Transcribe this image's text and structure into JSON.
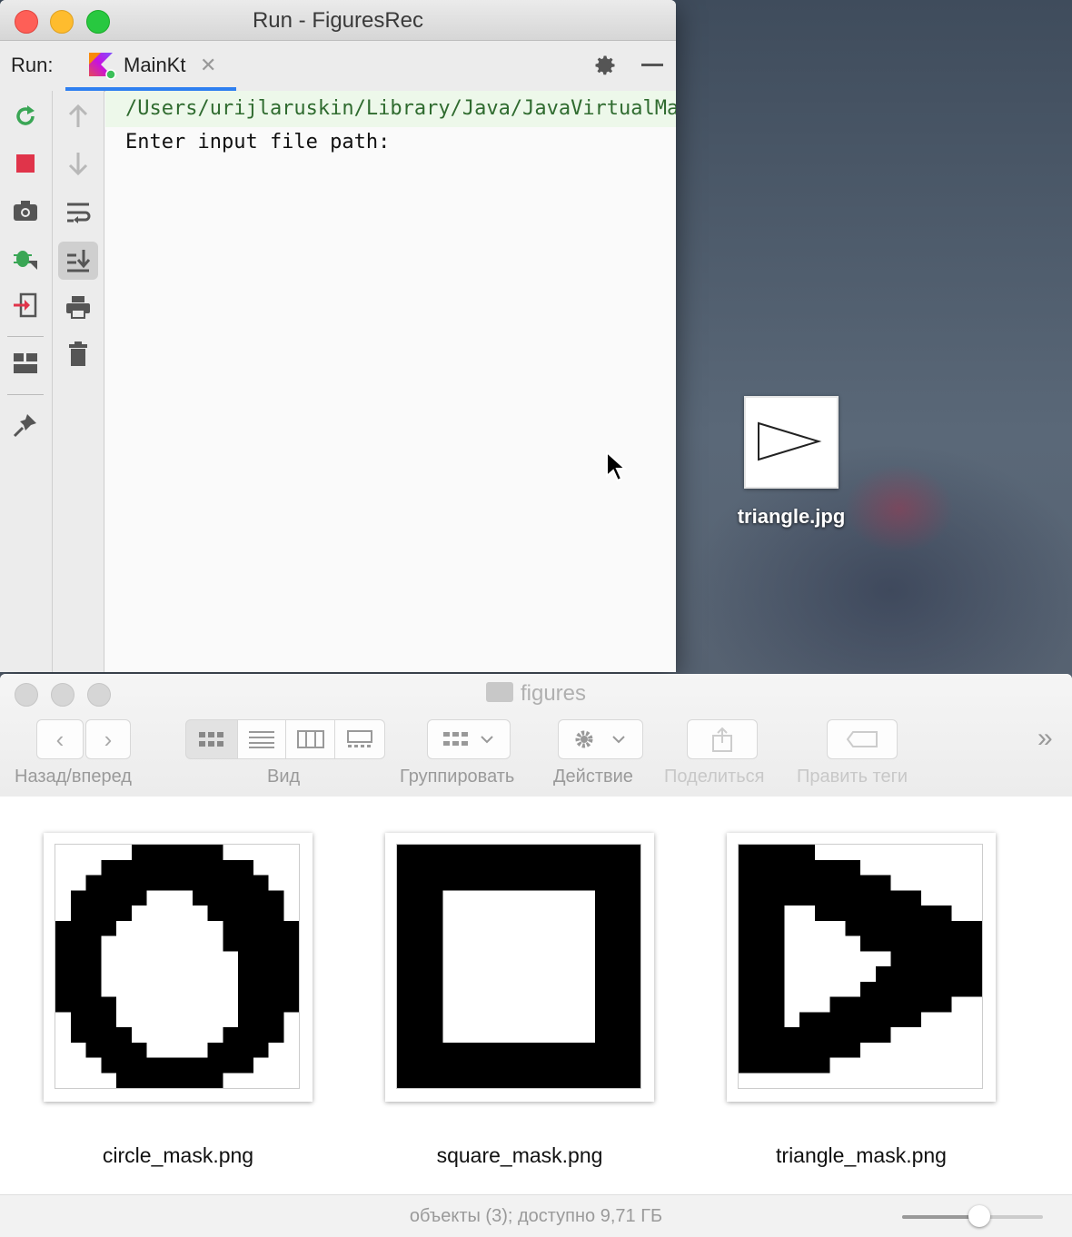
{
  "run_window": {
    "title": "Run - FiguresRec",
    "run_label": "Run:",
    "tab_label": "MainKt",
    "console_lines": [
      "/Users/urijlaruskin/Library/Java/JavaVirtualMachines",
      "Enter input file path:"
    ]
  },
  "desktop": {
    "icon_label": "triangle.jpg"
  },
  "finder": {
    "title": "figures",
    "toolbar_labels": {
      "back_forward": "Назад/вперед",
      "view": "Вид",
      "group": "Группировать",
      "action": "Действие",
      "share": "Поделиться",
      "tags": "Править теги"
    },
    "files": [
      {
        "name": "circle_mask.png"
      },
      {
        "name": "square_mask.png"
      },
      {
        "name": "triangle_mask.png"
      }
    ],
    "status": "объекты (3); доступно 9,71 ГБ",
    "zoom_fraction": 0.55
  },
  "colors": {
    "accent_blue": "#2e7ff0",
    "rerun_green": "#3aa655",
    "stop_red": "#e0344a",
    "console_green_bg": "#edf8ea"
  }
}
